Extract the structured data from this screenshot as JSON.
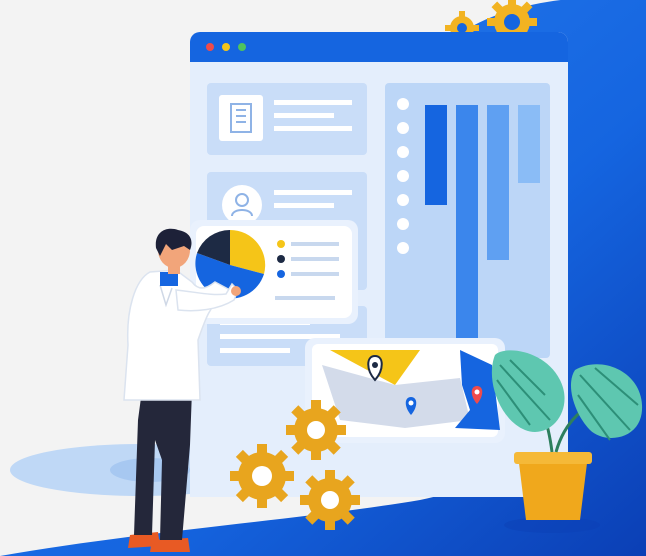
{
  "illustration": {
    "window_dots": [
      "red-dot",
      "yellow-dot",
      "green-dot"
    ],
    "icons": [
      "building-icon",
      "user-icon",
      "map-pin-icon",
      "gear-icon",
      "monstera-plant-icon"
    ],
    "colors": {
      "brand_blue": "#1565e0",
      "deep_blue": "#0d47c8",
      "light_blue": "#dbe8fb",
      "panel_blue": "#bcd6f7",
      "accent_yellow": "#f5c518",
      "gear_orange": "#e8a51e",
      "plant_teal": "#5ec7b0",
      "pot_orange": "#f0a81c",
      "background": "#f3f3f3"
    }
  }
}
